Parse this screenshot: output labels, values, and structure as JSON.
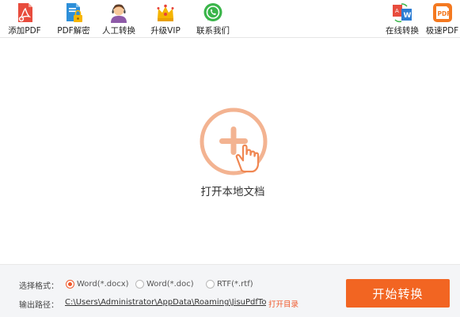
{
  "toolbar": {
    "add_pdf": {
      "label": "添加PDF",
      "icon": "add-pdf-icon"
    },
    "pdf_decrypt": {
      "label": "PDF解密",
      "icon": "lock-document-icon"
    },
    "manual_convert": {
      "label": "人工转换",
      "icon": "support-agent-icon"
    },
    "upgrade_vip": {
      "label": "升级VIP",
      "icon": "crown-icon"
    },
    "contact_us": {
      "label": "联系我们",
      "icon": "chat-bubble-icon"
    },
    "online_convert": {
      "label": "在线转换",
      "icon": "online-convert-icon"
    },
    "fast_pdf": {
      "label": "极速PDF",
      "icon": "fast-pdf-icon"
    }
  },
  "main": {
    "open_label": "打开本地文档",
    "icon": "add-file-hand-icon"
  },
  "bottom": {
    "format_label": "选择格式：",
    "formats": [
      {
        "label": "Word(*.docx)",
        "selected": true
      },
      {
        "label": "Word(*.doc)",
        "selected": false
      },
      {
        "label": "RTF(*.rtf)",
        "selected": false
      }
    ],
    "output_label": "输出路径：",
    "output_path": "C:\\Users\\Administrator\\AppData\\Roaming\\JisuPdfToWc",
    "open_dir": "打开目录",
    "start_button": "开始转换"
  },
  "colors": {
    "accent": "#f26522",
    "icon_ring": "#f3b391"
  }
}
